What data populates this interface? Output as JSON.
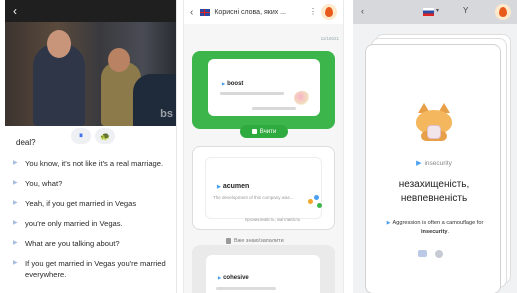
{
  "panel1": {
    "back_icon": "‹",
    "video_watermark": "bs",
    "pause_icon": "⏸",
    "turtle_icon": "🐢",
    "first_line": "deal?",
    "subtitles": [
      "You know, it's not like it's a real marriage.",
      "You, what?",
      "Yeah, if you get married in Vegas",
      "you're only married in Vegas.",
      "What are you talking about?",
      "If you get married in Vegas you're married everywhere."
    ]
  },
  "panel2": {
    "back_icon": "‹",
    "title": "Корисні слова, яких ...",
    "menu_icon": "⋮",
    "counter": "11/15021",
    "card1": {
      "word": "boost"
    },
    "learn_button": "Вчити",
    "card2": {
      "word": "acumen",
      "example": "The development of this company was...",
      "translation": "проникливість, кмітливість"
    },
    "know_label": "Вже знаю/запалити",
    "card3": {
      "word": "cohesive"
    }
  },
  "panel3": {
    "back_icon": "‹",
    "flag_caret": "▾",
    "filter_icon": "Y",
    "word": "insecurity",
    "translation_line1": "незахищеність,",
    "translation_line2": "невпевненість",
    "example_before": "Aggression is often a camouflage for ",
    "example_word": "insecurity",
    "example_after": "."
  },
  "colors": {
    "green_card": "#3cb54a",
    "accent_blue": "#4aa0f0",
    "avatar_orange": "#e85a1b"
  }
}
